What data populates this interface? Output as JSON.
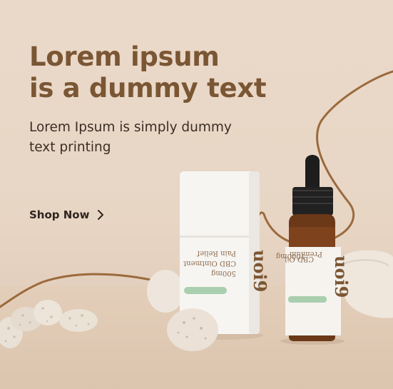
{
  "hero": {
    "headline_line1": "Lorem ipsum",
    "headline_line2": "is a dummy text",
    "subtitle_line1": "Lorem Ipsum is simply dummy",
    "subtitle_line2": "text printing"
  },
  "cta": {
    "label": "Shop Now",
    "icon": "chevron-right-icon"
  },
  "products": {
    "ointment": {
      "brand": "uoi9",
      "line1": "Pain Relief",
      "line2": "CBD Ointment",
      "line3": "500mg"
    },
    "oil": {
      "brand": "uoi9",
      "line1": "Premium",
      "line2": "CBD Oil",
      "line3": "1000mg"
    }
  },
  "colors": {
    "headline": "#7a5634",
    "swoosh": "#9b6a3c",
    "background": "#ead9c9",
    "label_green": "#a9cfae"
  }
}
